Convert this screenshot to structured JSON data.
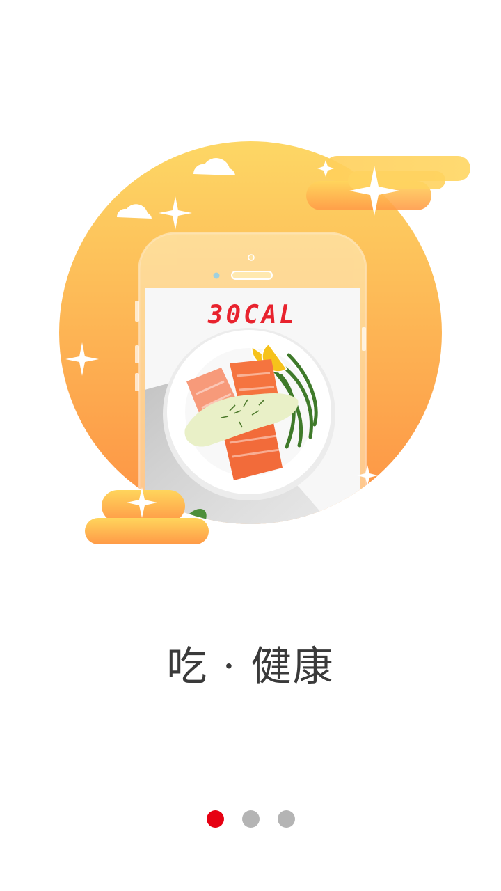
{
  "onboarding": {
    "screen_label": "30CAL",
    "slogan": "吃 · 健康",
    "pager": {
      "total": 3,
      "active_index": 0
    }
  },
  "colors": {
    "sun_top": "#FDD765",
    "sun_bottom": "#FD9143",
    "cloud_top": "#FFD55C",
    "cloud_bottom": "#FF9A47",
    "lcd_red": "#E8232E",
    "dot_active": "#E60012",
    "dot_inactive": "#B4B4B4",
    "slogan_text": "#3A3A3A"
  },
  "icons": [
    "cloud-icon",
    "sparkle-icon",
    "phone-illustration",
    "salmon-plate-illustration"
  ]
}
